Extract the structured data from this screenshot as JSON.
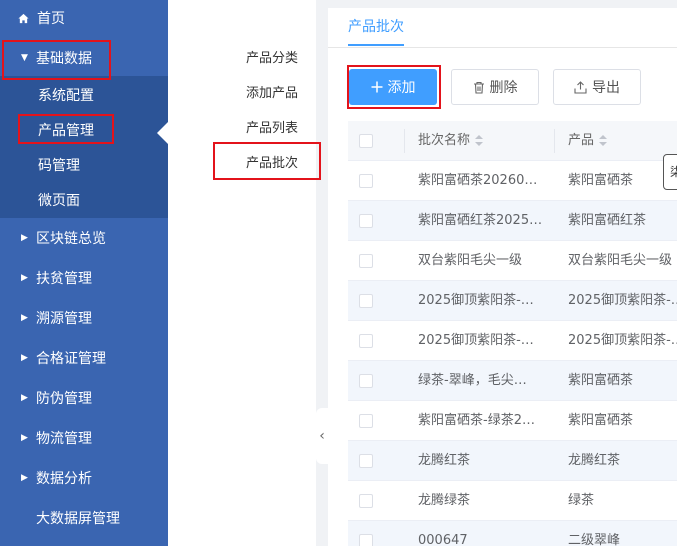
{
  "sidebar": {
    "home": {
      "label": "首页",
      "icon": "home-icon"
    },
    "items": [
      {
        "label": "基础数据",
        "expanded": true
      },
      {
        "label": "区块链总览"
      },
      {
        "label": "扶贫管理"
      },
      {
        "label": "溯源管理"
      },
      {
        "label": "合格证管理"
      },
      {
        "label": "防伪管理"
      },
      {
        "label": "物流管理"
      },
      {
        "label": "数据分析"
      },
      {
        "label": "大数据屏管理"
      }
    ],
    "submenu": [
      {
        "label": "系统配置"
      },
      {
        "label": "产品管理",
        "active": true
      },
      {
        "label": "码管理"
      },
      {
        "label": "微页面"
      }
    ]
  },
  "subpanel": {
    "items": [
      {
        "label": "产品分类"
      },
      {
        "label": "添加产品"
      },
      {
        "label": "产品列表"
      },
      {
        "label": "产品批次",
        "active": true
      }
    ]
  },
  "main": {
    "tab": "产品批次",
    "toolbar": {
      "add": "添加",
      "delete": "删除",
      "export": "导出"
    },
    "table": {
      "columns": [
        "批次名称",
        "产品"
      ],
      "rows": [
        [
          "紫阳富硒茶20260…",
          "紫阳富硒茶"
        ],
        [
          "紫阳富硒红茶2025…",
          "紫阳富硒红茶"
        ],
        [
          "双台紫阳毛尖一级",
          "双台紫阳毛尖一级"
        ],
        [
          "2025御顶紫阳茶-…",
          "2025御顶紫阳茶-…"
        ],
        [
          "2025御顶紫阳茶-…",
          "2025御顶紫阳茶-…"
        ],
        [
          "绿茶-翠峰，毛尖…",
          "紫阳富硒茶"
        ],
        [
          "紫阳富硒茶-绿茶2…",
          "紫阳富硒茶"
        ],
        [
          "龙腾红茶",
          "龙腾红茶"
        ],
        [
          "龙腾绿茶",
          "绿茶"
        ],
        [
          "000647",
          "二级翠峰"
        ]
      ],
      "tooltip_fragment": "柒"
    }
  },
  "colors": {
    "sidebar_bg": "#3a65b1",
    "submenu_bg": "#2c5497",
    "accent": "#409eff",
    "highlight_box": "#e3131b"
  }
}
